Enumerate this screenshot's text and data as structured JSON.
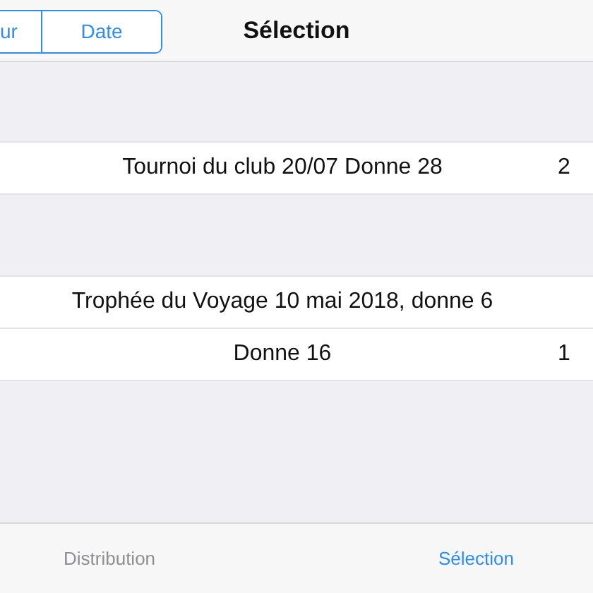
{
  "nav_bar": {
    "segments": [
      {
        "label": "ur",
        "selected": false
      },
      {
        "label": "Date",
        "selected": false
      }
    ],
    "title": "Sélection"
  },
  "sections": [
    {
      "rows": [
        {
          "title": "Tournoi du club 20/07 Donne 28",
          "detail": "2"
        }
      ]
    },
    {
      "rows": [
        {
          "title": "Trophée du Voyage 10 mai 2018, donne 6"
        },
        {
          "title": "Donne 16",
          "detail": "1"
        }
      ]
    }
  ],
  "tab_bar": [
    {
      "label": "Distribution",
      "selected": false
    },
    {
      "label": "Sélection",
      "selected": true
    }
  ]
}
